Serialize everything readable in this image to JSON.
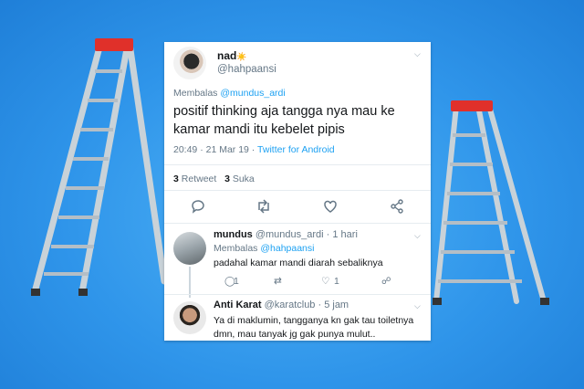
{
  "tweet": {
    "name": "nad",
    "emoji": "☀️",
    "handle": "@hahpaansi",
    "reply_prefix": "Membalas",
    "reply_to": "@mundus_ardi",
    "text": "positif thinking aja tangga nya mau ke kamar mandi itu kebelet pipis",
    "time": "20:49 · 21 Mar 19 · ",
    "source": "Twitter for Android",
    "retweets_count": "3",
    "retweets_label": "Retweet",
    "likes_count": "3",
    "likes_label": "Suka"
  },
  "replies": [
    {
      "name": "mundus",
      "handle": "@mundus_ardi · 1 hari",
      "reply_prefix": "Membalas",
      "reply_to": "@hahpaansi",
      "text": "padahal kamar mandi diarah sebaliknya",
      "reply_count": "1",
      "like_count": "1"
    },
    {
      "name": "Anti Karat",
      "handle": "@karatclub · 5 jam",
      "text": "Ya di maklumin, tangganya kn gak tau toiletnya dmn, mau tanyak jg gak punya mulut.."
    }
  ],
  "colors": {
    "accent": "#1da1f2",
    "background": "#2f95ea",
    "ladder_cap": "#e0302a"
  },
  "icons": [
    "reply-icon",
    "retweet-icon",
    "like-icon",
    "share-icon",
    "chevron-down-icon"
  ]
}
